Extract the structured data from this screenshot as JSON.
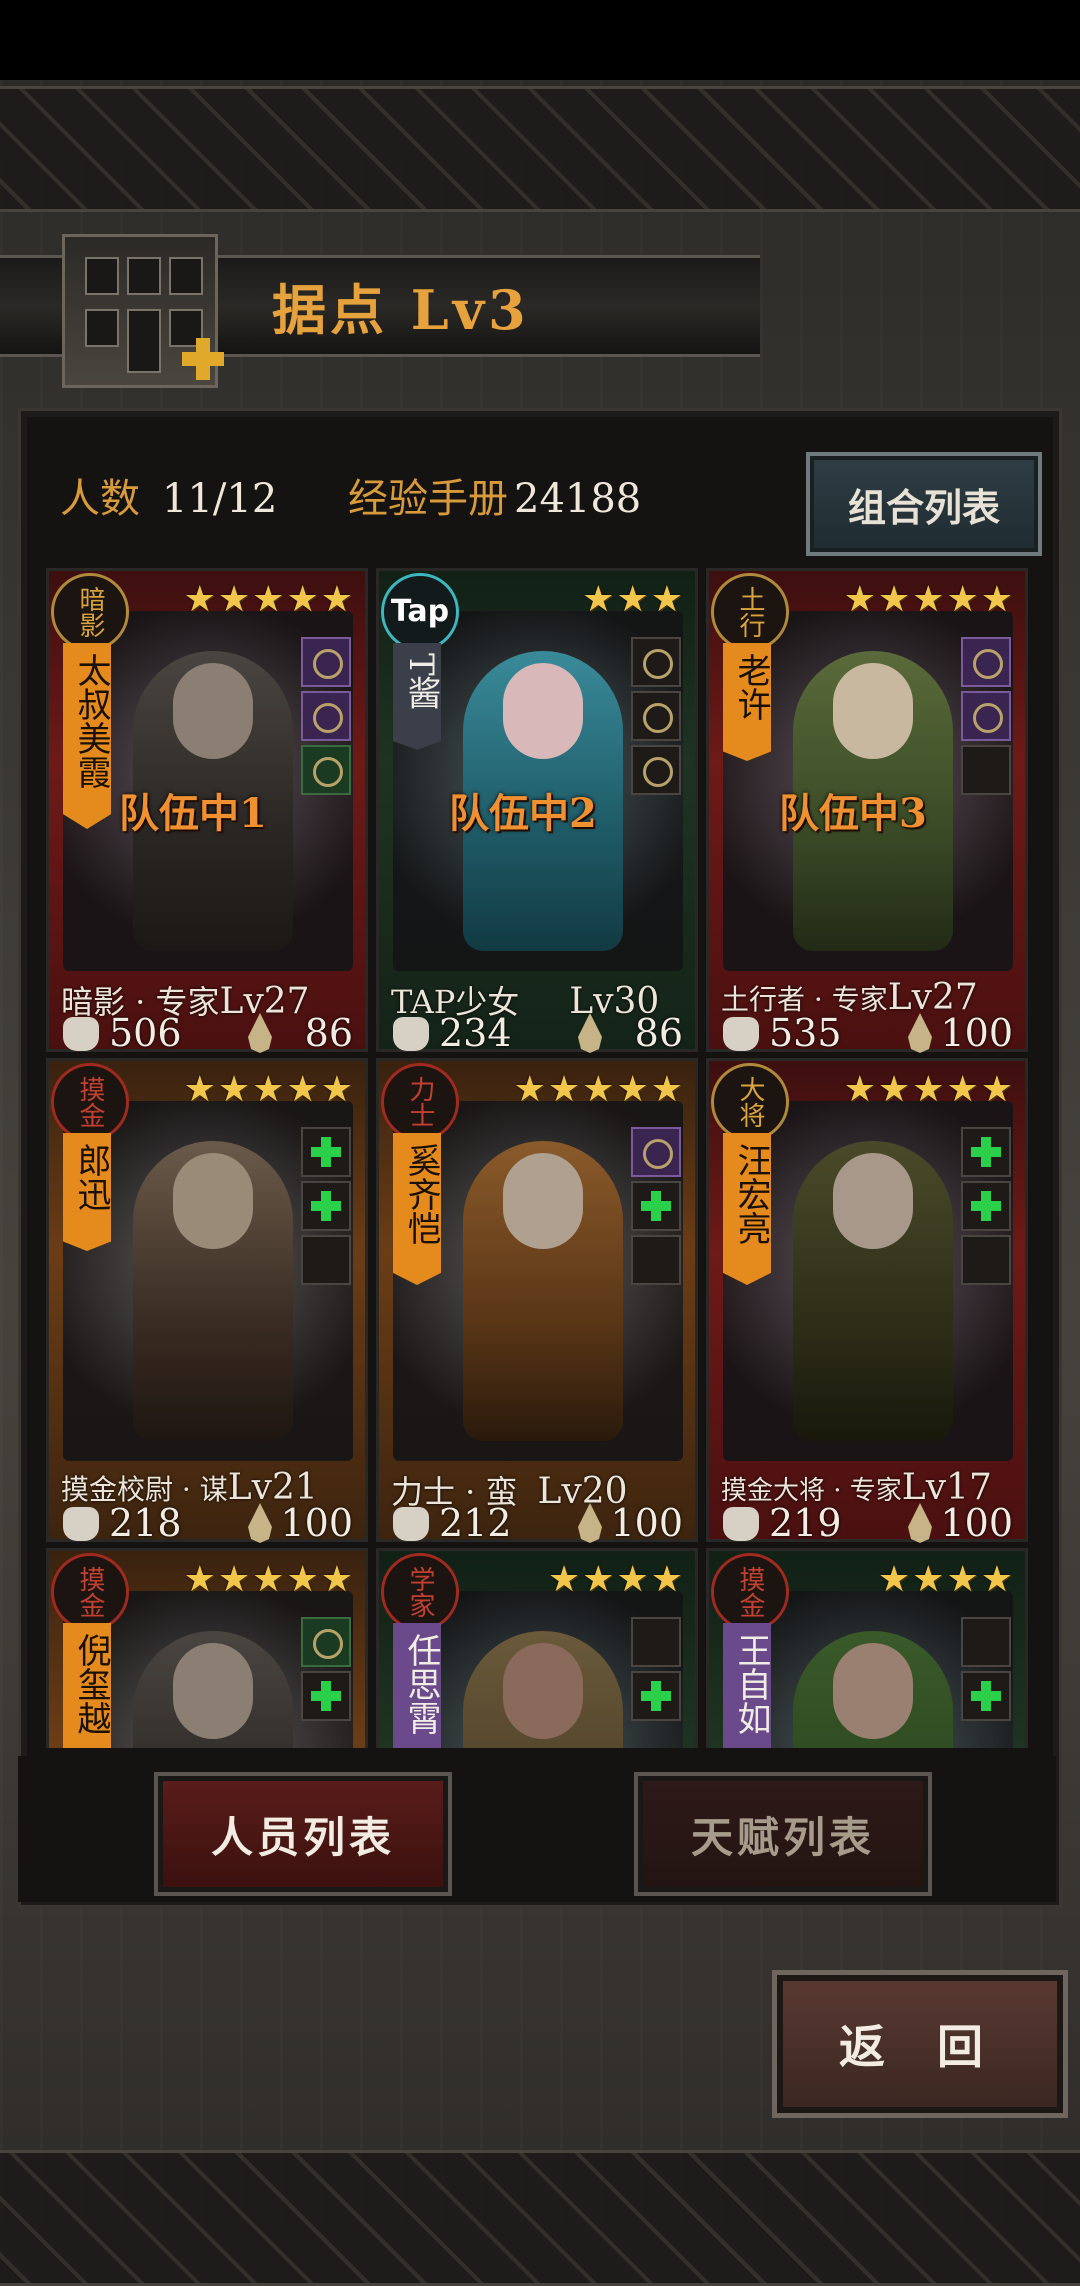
{
  "header": {
    "title": "据点  Lv3"
  },
  "stats": {
    "members_label": "人数",
    "members_value": "11/12",
    "exp_label": "经验手册",
    "exp_value": "24188"
  },
  "combo_button": "组合列表",
  "cards": [
    {
      "badge": "暗影",
      "stars": "★★★★★",
      "name": "太叔美霞",
      "status": "队伍中1",
      "class": "暗影 · 专家",
      "lv": "Lv27",
      "atk": "506",
      "hp": "86"
    },
    {
      "badge": "Tap",
      "stars": "★★★",
      "name": "T酱",
      "status": "队伍中2",
      "class": "TAP少女",
      "lv": "Lv30",
      "atk": "234",
      "hp": "86"
    },
    {
      "badge": "土行",
      "stars": "★★★★★",
      "name": "老许",
      "status": "队伍中3",
      "class": "土行者 · 专家",
      "lv": "Lv27",
      "atk": "535",
      "hp": "100"
    },
    {
      "badge": "摸金",
      "stars": "★★★★★",
      "name": "郎迅",
      "status": "",
      "class": "摸金校尉 · 谋",
      "lv": "Lv21",
      "atk": "218",
      "hp": "100"
    },
    {
      "badge": "力士",
      "stars": "★★★★★",
      "name": "奚齐恺",
      "status": "",
      "class": "力士 · 蛮",
      "lv": "Lv20",
      "atk": "212",
      "hp": "100"
    },
    {
      "badge": "大将",
      "stars": "★★★★★",
      "name": "汪宏亮",
      "status": "",
      "class": "摸金大将 · 专家",
      "lv": "Lv17",
      "atk": "219",
      "hp": "100"
    },
    {
      "badge": "摸金",
      "stars": "★★★★★",
      "name": "倪玺越",
      "status": "",
      "class": "",
      "lv": "",
      "atk": "",
      "hp": ""
    },
    {
      "badge": "学家",
      "stars": "★★★★",
      "name": "任思霄",
      "status": "",
      "class": "",
      "lv": "",
      "atk": "",
      "hp": ""
    },
    {
      "badge": "摸金",
      "stars": "★★★★",
      "name": "王自如",
      "status": "",
      "class": "",
      "lv": "",
      "atk": "",
      "hp": ""
    }
  ],
  "tabs": {
    "personnel": "人员列表",
    "talent": "天赋列表"
  },
  "back_button": "返 回",
  "colors": {
    "accent": "#e6a23c",
    "plus_green": "#2ad04a",
    "star": "#f1c64a"
  },
  "icons": [
    "plus-icon",
    "star-icon",
    "fist-icon",
    "drop-icon"
  ]
}
